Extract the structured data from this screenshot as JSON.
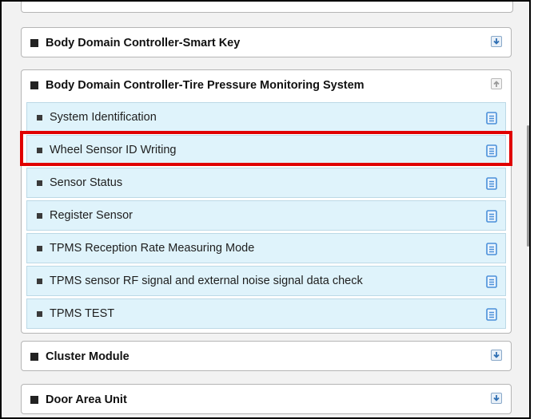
{
  "panels": [
    {
      "title": "Body Domain Controller-Smart Key",
      "toggle": "download-icon"
    },
    {
      "title": "Body Domain Controller-Tire Pressure Monitoring System",
      "toggle": "upload-icon",
      "items": [
        {
          "label": "System Identification"
        },
        {
          "label": "Wheel Sensor ID Writing"
        },
        {
          "label": "Sensor Status"
        },
        {
          "label": "Register Sensor"
        },
        {
          "label": "TPMS Reception Rate Measuring Mode"
        },
        {
          "label": "TPMS sensor RF signal and external noise signal data check"
        },
        {
          "label": "TPMS TEST"
        }
      ]
    },
    {
      "title": "Cluster Module",
      "toggle": "download-icon"
    },
    {
      "title": "Door Area Unit",
      "toggle": "download-icon"
    }
  ],
  "item_icon": "document-icon",
  "highlighted_item": "Wheel Sensor ID Writing",
  "colors": {
    "item_bg": "#dff3fb",
    "highlight": "#e00000",
    "icon_blue": "#4a90d9"
  }
}
